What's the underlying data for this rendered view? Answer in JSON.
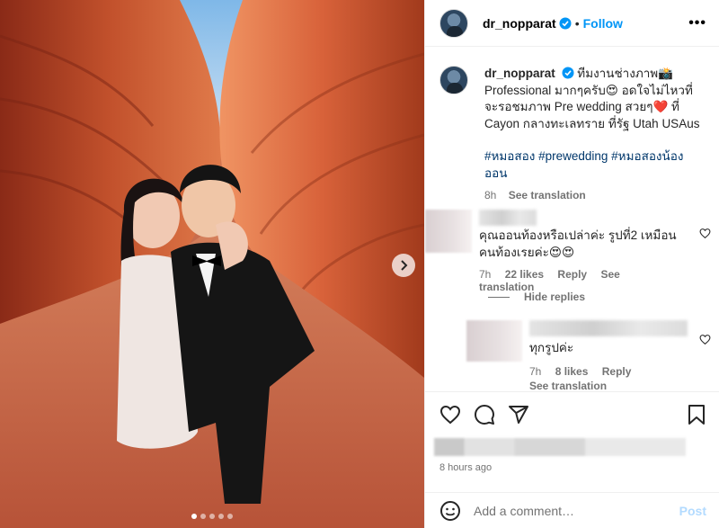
{
  "header": {
    "username": "dr_nopparat",
    "separator": "•",
    "follow_label": "Follow",
    "more_label": "•••"
  },
  "caption": {
    "username": "dr_nopparat",
    "text": "ทีมงานช่างภาพ📸 Professional มากๆครับ😍 อดใจไม่ไหวที่จะรอชมภาพ Pre wedding สวยๆ❤️ ที่ Cayon กลางทะเลทราย ที่รัฐ Utah USAus",
    "hashtags": "#หมอสอง #prewedding #หมอสองน้องออน",
    "time": "8h",
    "see_translation": "See translation"
  },
  "comments": [
    {
      "text": "คุณออนท้องหรือเปล่าค่ะ รูปที่2 เหมือนคนท้องเรยค่ะ😍😍",
      "time": "7h",
      "likes": "22 likes",
      "reply": "Reply",
      "see_translation": "See translation"
    }
  ],
  "hide_replies": "Hide replies",
  "replies": [
    {
      "text": "ทุกรูปค่ะ",
      "time": "7h",
      "likes": "8 likes",
      "reply": "Reply",
      "see_translation": "See translation"
    }
  ],
  "footer": {
    "time_ago": "8 hours ago",
    "comment_placeholder": "Add a comment…",
    "post_label": "Post"
  },
  "carousel": {
    "slides": 5,
    "active": 1
  },
  "icons": [
    "verified-badge-icon",
    "more-icon",
    "chevron-right-icon",
    "heart-icon",
    "comment-icon",
    "share-icon",
    "bookmark-icon",
    "emoji-icon"
  ],
  "colors": {
    "accent": "#0095f6",
    "hashtag": "#00376b",
    "muted": "#737373",
    "post_disabled": "#b3dbff",
    "canyon": "#c2512c"
  }
}
